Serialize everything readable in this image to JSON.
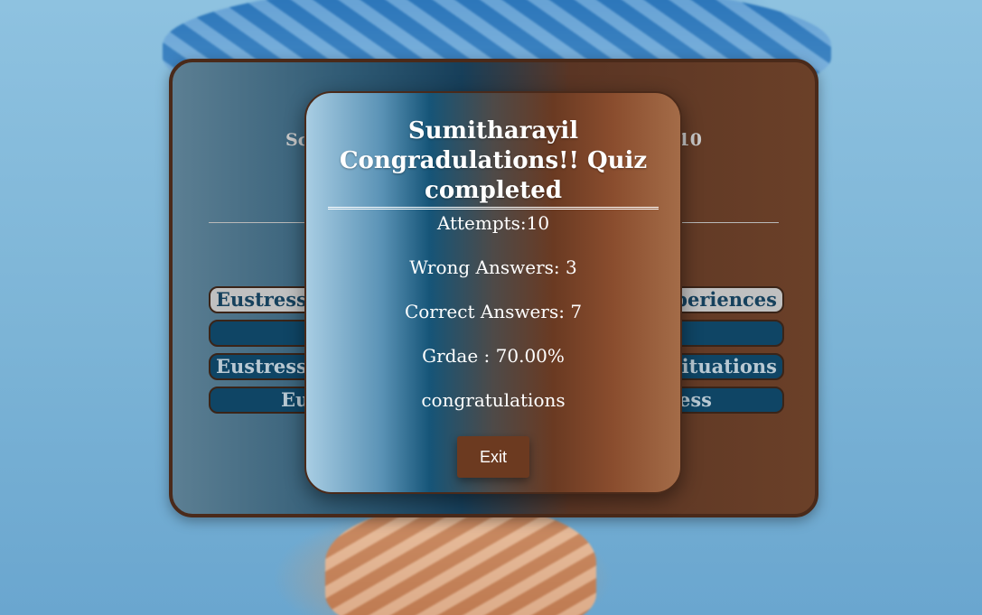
{
  "quiz": {
    "score_left": "Sc",
    "score_right": "10",
    "options": [
      {
        "left": "Eustress: 1",
        "right": "xperiences"
      },
      {
        "left": "",
        "right": ""
      },
      {
        "left": "Eustress:",
        "right": "situations"
      },
      {
        "left": "Eu",
        "right": "ess"
      }
    ]
  },
  "modal": {
    "title": "Sumitharayil Congradulations!! Quiz completed",
    "attempts": "Attempts:10",
    "wrong": "Wrong Answers: 3",
    "correct": "Correct Answers: 7",
    "grade": "Grdae : 70.00%",
    "message": "congratulations",
    "exit_label": "Exit"
  }
}
